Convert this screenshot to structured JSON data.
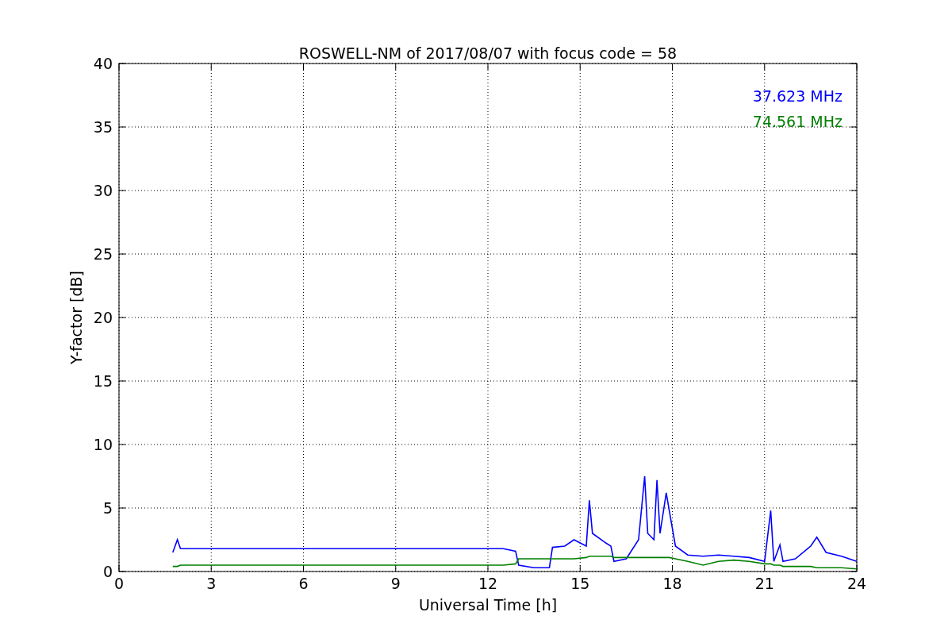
{
  "figure": {
    "chart_data": {
      "type": "line",
      "title": "ROSWELL-NM of 2017/08/07 with focus code = 58",
      "xlabel": "Universal Time [h]",
      "ylabel": "Y-factor [dB]",
      "xlim": [
        0,
        24
      ],
      "ylim": [
        0,
        40
      ],
      "xticks": [
        0,
        3,
        6,
        9,
        12,
        15,
        18,
        21,
        24
      ],
      "yticks": [
        0,
        5,
        10,
        15,
        20,
        25,
        30,
        35,
        40
      ],
      "grid": true,
      "x": [
        1.75,
        1.9,
        2.0,
        12.0,
        12.5,
        12.9,
        13.0,
        13.5,
        14.0,
        14.1,
        14.5,
        14.8,
        15.2,
        15.3,
        15.4,
        15.8,
        16.0,
        16.1,
        16.5,
        16.9,
        17.1,
        17.2,
        17.4,
        17.5,
        17.6,
        17.8,
        17.9,
        18.1,
        18.5,
        19.0,
        19.5,
        20.0,
        20.5,
        21.0,
        21.2,
        21.3,
        21.5,
        21.6,
        22.0,
        22.5,
        22.7,
        23.0,
        23.5,
        24.0
      ],
      "series": [
        {
          "name": "37.623 MHz",
          "color": "#0000ff",
          "values": [
            1.5,
            2.5,
            1.8,
            1.8,
            1.8,
            1.6,
            0.5,
            0.3,
            0.3,
            1.9,
            2.0,
            2.5,
            2.0,
            5.6,
            3.0,
            2.3,
            2.0,
            0.8,
            1.0,
            2.5,
            7.5,
            3.0,
            2.5,
            7.2,
            3.0,
            6.2,
            4.8,
            2.0,
            1.3,
            1.2,
            1.3,
            1.2,
            1.1,
            0.8,
            4.8,
            0.8,
            2.1,
            0.8,
            1.0,
            2.0,
            2.7,
            1.5,
            1.2,
            0.8
          ]
        },
        {
          "name": "74.561 MHz",
          "color": "#008000",
          "values": [
            0.4,
            0.4,
            0.5,
            0.5,
            0.5,
            0.6,
            1.0,
            1.0,
            1.0,
            1.0,
            1.0,
            1.0,
            1.1,
            1.2,
            1.2,
            1.2,
            1.2,
            1.1,
            1.1,
            1.1,
            1.1,
            1.1,
            1.1,
            1.1,
            1.1,
            1.1,
            1.1,
            1.0,
            0.8,
            0.5,
            0.8,
            0.9,
            0.8,
            0.6,
            0.6,
            0.5,
            0.5,
            0.4,
            0.4,
            0.4,
            0.3,
            0.3,
            0.3,
            0.2
          ]
        }
      ]
    }
  }
}
